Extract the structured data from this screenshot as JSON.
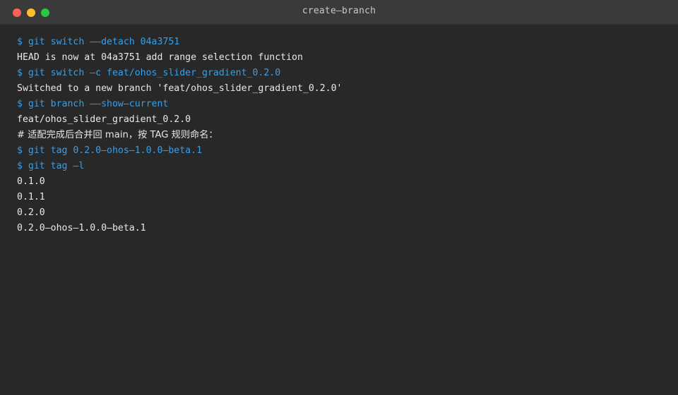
{
  "window": {
    "title": "create—branch"
  },
  "colors": {
    "command": "#3a9ee4",
    "output": "#e8e8e8",
    "background": "#282828",
    "titlebar": "#3a3a3a"
  },
  "lines": [
    {
      "type": "cmd",
      "text": "$ git switch ——detach 04a3751"
    },
    {
      "type": "out",
      "text": "HEAD is now at 04a3751 add range selection function"
    },
    {
      "type": "cmd",
      "text": "$ git switch —c feat/ohos_slider_gradient_0.2.0"
    },
    {
      "type": "out",
      "text": "Switched to a new branch 'feat/ohos_slider_gradient_0.2.0'"
    },
    {
      "type": "cmd",
      "text": "$ git branch ——show—current"
    },
    {
      "type": "out",
      "text": "feat/ohos_slider_gradient_0.2.0"
    },
    {
      "type": "comment",
      "text": "# 适配完成后合并回 main，按 TAG 规则命名："
    },
    {
      "type": "cmd",
      "text": "$ git tag 0.2.0—ohos—1.0.0—beta.1"
    },
    {
      "type": "cmd",
      "text": "$ git tag —l"
    },
    {
      "type": "out",
      "text": "0.1.0"
    },
    {
      "type": "out",
      "text": "0.1.1"
    },
    {
      "type": "out",
      "text": "0.2.0"
    },
    {
      "type": "out",
      "text": "0.2.0—ohos—1.0.0—beta.1"
    }
  ]
}
